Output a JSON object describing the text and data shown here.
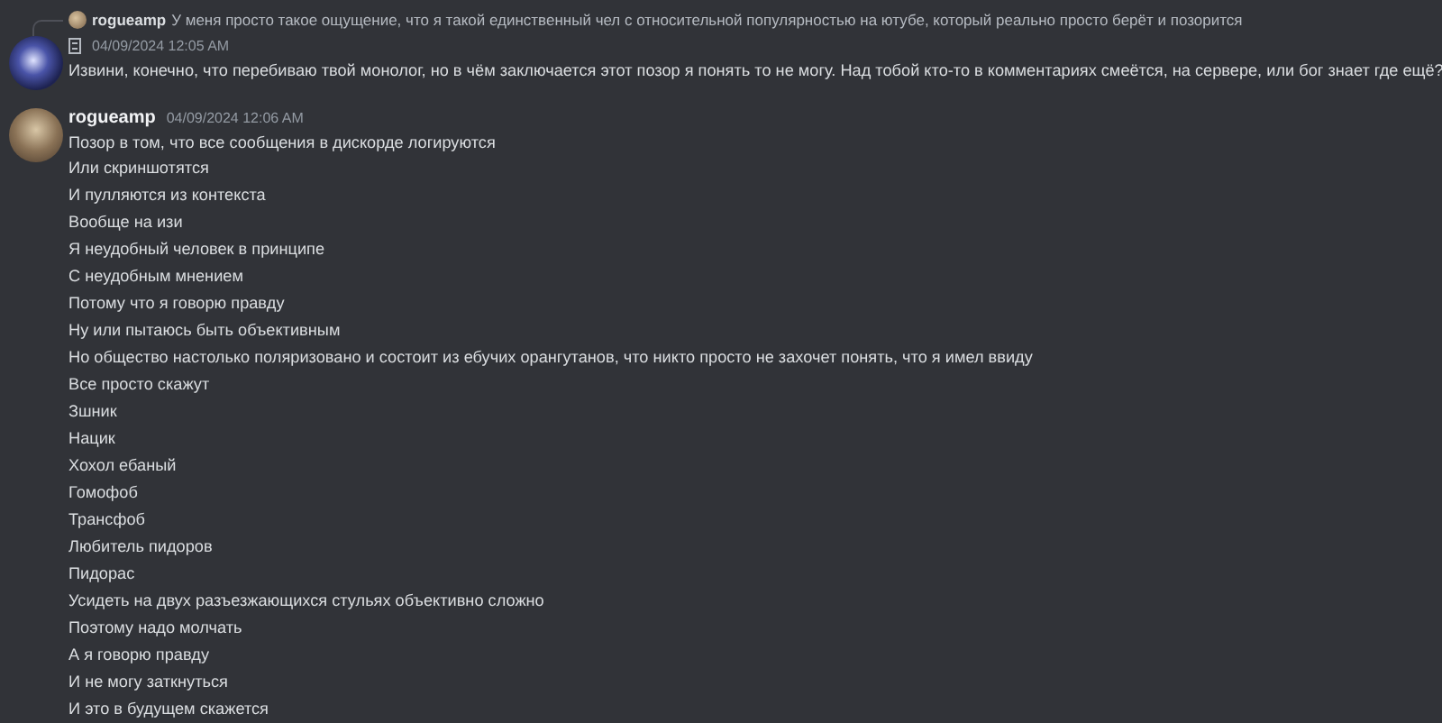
{
  "messages": [
    {
      "reply": {
        "author": "rogueamp",
        "text": "У меня просто такое ощущение, что я такой единственный чел с относительной популярностью на ютубе, который реально просто берёт и позорится"
      },
      "timestamp": "04/09/2024 12:05 AM",
      "lines": [
        "Извини, конечно, что перебиваю твой монолог, но в чём заключается этот позор я понять то не могу. Над тобой кто-то в комментариях смеётся, на сервере, или бог знает где ещё?"
      ]
    },
    {
      "author": "rogueamp",
      "timestamp": "04/09/2024 12:06 AM",
      "lines": [
        "Позор в том, что все сообщения в дискорде логируются",
        "Или скриншотятся",
        "И пулляются из контекста",
        "Вообще на изи",
        "Я неудобный человек в принципе",
        "С неудобным мнением",
        "Потому что я говорю правду",
        "Ну или пытаюсь быть объективным",
        "Но общество настолько поляризовано и состоит из ебучих орангутанов, что никто просто не захочет понять, что я имел ввиду",
        "Все просто скажут",
        "Зшник",
        "Нацик",
        "Хохол ебаный",
        "Гомофоб",
        "Трансфоб",
        "Любитель пидоров",
        "Пидорас",
        "Усидеть на двух разъезжающихся стульях объективно сложно",
        "Поэтому надо молчать",
        "А я говорю правду",
        "И не могу заткнуться",
        "И это в будущем скажется"
      ]
    }
  ]
}
